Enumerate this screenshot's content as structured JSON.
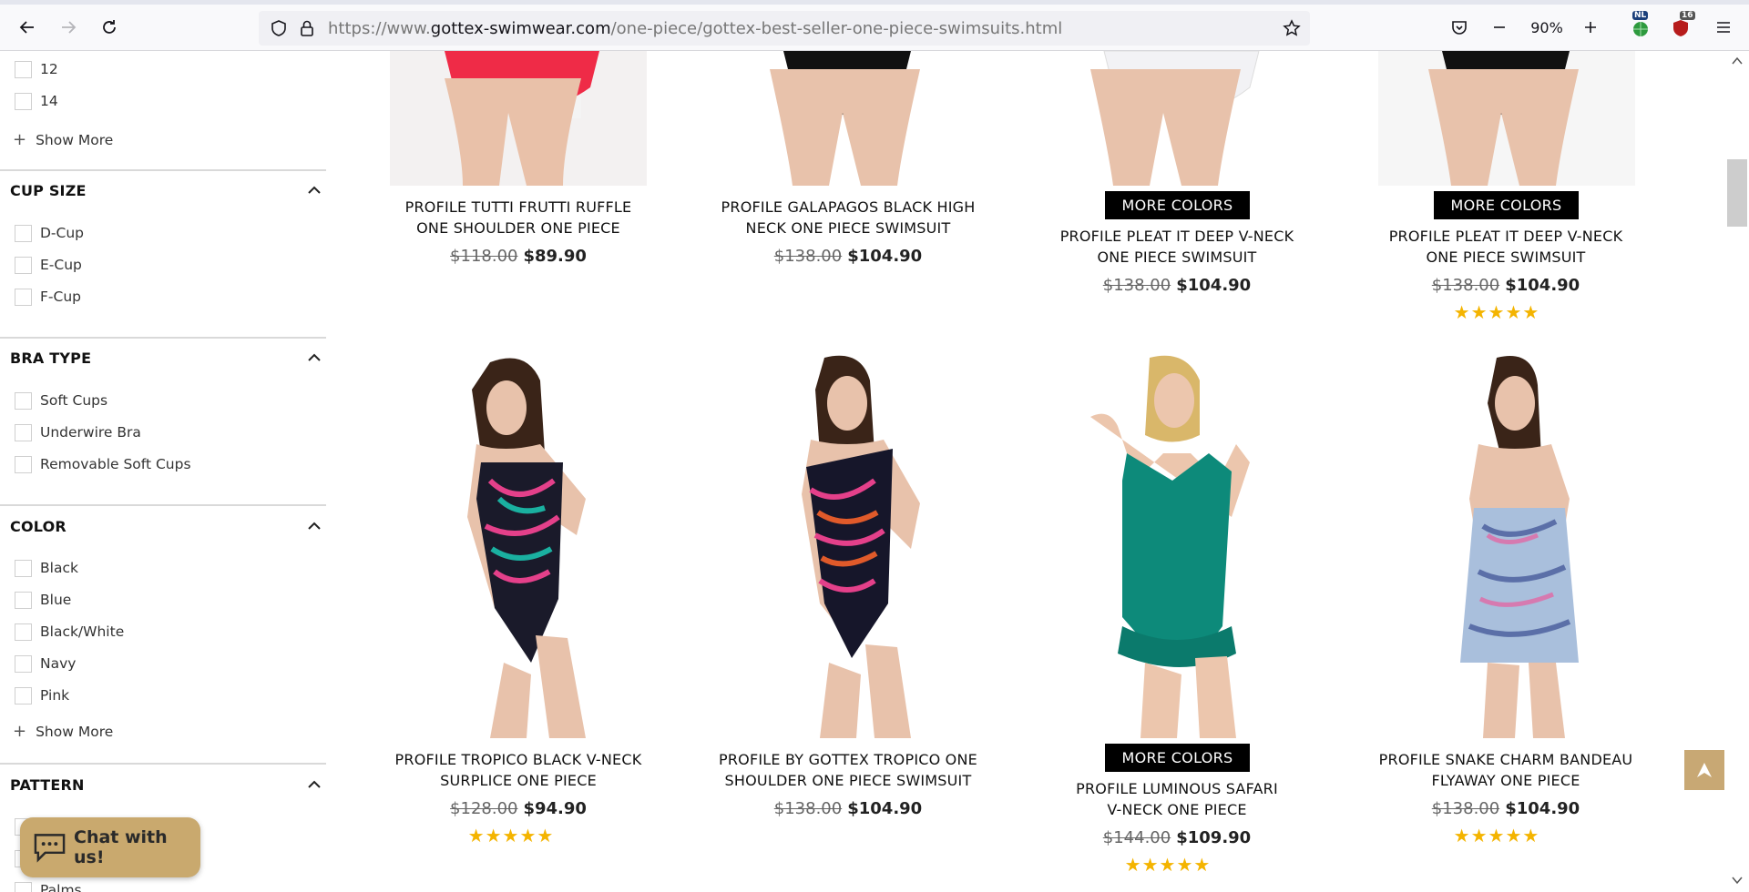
{
  "browser": {
    "url_prefix": "https://www.",
    "url_domain": "gottex-swimwear.com",
    "url_path": "/one-piece/gottex-best-seller-one-piece-swimsuits.html",
    "zoom": "90%",
    "ext_nl": "NL",
    "ext_count": "16"
  },
  "sidebar": {
    "size_options": [
      "12",
      "14"
    ],
    "size_showmore": "Show More",
    "cup_title": "CUP SIZE",
    "cup_options": [
      "D-Cup",
      "E-Cup",
      "F-Cup"
    ],
    "bra_title": "BRA TYPE",
    "bra_options": [
      "Soft Cups",
      "Underwire Bra",
      "Removable Soft Cups"
    ],
    "color_title": "COLOR",
    "color_options": [
      "Black",
      "Blue",
      "Black/White",
      "Navy",
      "Pink"
    ],
    "color_showmore": "Show More",
    "pattern_title": "PATTERN",
    "pattern_partial": "Palms"
  },
  "products": [
    {
      "title_l1": "PROFILE TUTTI FRUTTI RUFFLE",
      "title_l2": "ONE SHOULDER ONE PIECE",
      "old": "$118.00",
      "new": "$89.90"
    },
    {
      "title_l1": "PROFILE GALAPAGOS BLACK HIGH",
      "title_l2": "NECK ONE PIECE SWIMSUIT",
      "old": "$138.00",
      "new": "$104.90"
    },
    {
      "title_l1": "PROFILE PLEAT IT DEEP V-NECK",
      "title_l2": "ONE PIECE SWIMSUIT",
      "old": "$138.00",
      "new": "$104.90",
      "badge": "MORE COLORS"
    },
    {
      "title_l1": "PROFILE PLEAT IT DEEP V-NECK",
      "title_l2": "ONE PIECE SWIMSUIT",
      "old": "$138.00",
      "new": "$104.90",
      "badge": "MORE COLORS",
      "stars": "★★★★★"
    },
    {
      "title_l1": "PROFILE TROPICO BLACK V-NECK",
      "title_l2": "SURPLICE ONE PIECE",
      "old": "$128.00",
      "new": "$94.90",
      "stars": "★★★★★"
    },
    {
      "title_l1": "PROFILE BY GOTTEX TROPICO ONE",
      "title_l2": "SHOULDER ONE PIECE SWIMSUIT",
      "old": "$138.00",
      "new": "$104.90"
    },
    {
      "title_l1": "PROFILE LUMINOUS SAFARI",
      "title_l2": "V-NECK ONE PIECE",
      "old": "$144.00",
      "new": "$109.90",
      "badge": "MORE COLORS",
      "stars": "★★★★★"
    },
    {
      "title_l1": "PROFILE SNAKE CHARM BANDEAU",
      "title_l2": "FLYAWAY ONE PIECE",
      "old": "$138.00",
      "new": "$104.90",
      "stars": "★★★★★"
    }
  ],
  "chat": {
    "label": "Chat with us!"
  },
  "colors": {
    "accent": "#c8a874",
    "stars": "#f4b400",
    "badge": "#000000"
  }
}
